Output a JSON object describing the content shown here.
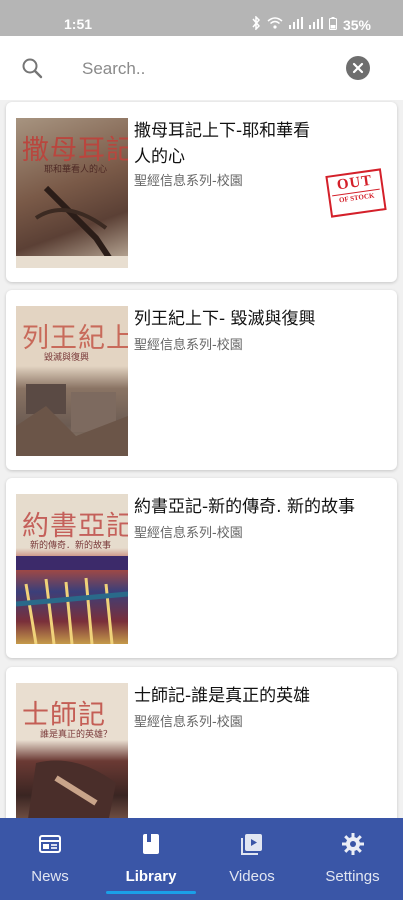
{
  "status_bar": {
    "time": "1:51",
    "battery": "35%"
  },
  "search": {
    "placeholder": "Search.."
  },
  "books": [
    {
      "title": "撒母耳記上下-耶和華看人的心",
      "series": "聖經信息系列-校園",
      "cover_title": "撒母耳記上下",
      "cover_subtitle": "耶和華看人的心",
      "out_of_stock": true,
      "badge_top": "OUT",
      "badge_bottom": "OF STOCK"
    },
    {
      "title": "列王紀上下- 毀滅與復興",
      "series": "聖經信息系列-校園",
      "cover_title": "列王紀上下",
      "cover_subtitle": "毀滅與復興",
      "out_of_stock": false
    },
    {
      "title": "約書亞記-新的傳奇. 新的故事",
      "series": "聖經信息系列-校園",
      "cover_title": "約書亞記",
      "cover_subtitle": "新的傳奇．新的故事",
      "out_of_stock": false
    },
    {
      "title": "士師記-誰是真正的英雄",
      "series": "聖經信息系列-校園",
      "cover_title": "士師記",
      "cover_subtitle": "誰是真正的英雄？",
      "out_of_stock": false
    }
  ],
  "nav": {
    "items": [
      {
        "label": "News",
        "icon": "news-icon",
        "active": false
      },
      {
        "label": "Library",
        "icon": "library-icon",
        "active": true
      },
      {
        "label": "Videos",
        "icon": "videos-icon",
        "active": false
      },
      {
        "label": "Settings",
        "icon": "settings-icon",
        "active": false
      }
    ]
  },
  "colors": {
    "nav_background": "#3a56a7",
    "nav_indicator": "#1aa0e8",
    "status_bar": "#b5b5b5",
    "out_of_stock": "#d4202a"
  }
}
